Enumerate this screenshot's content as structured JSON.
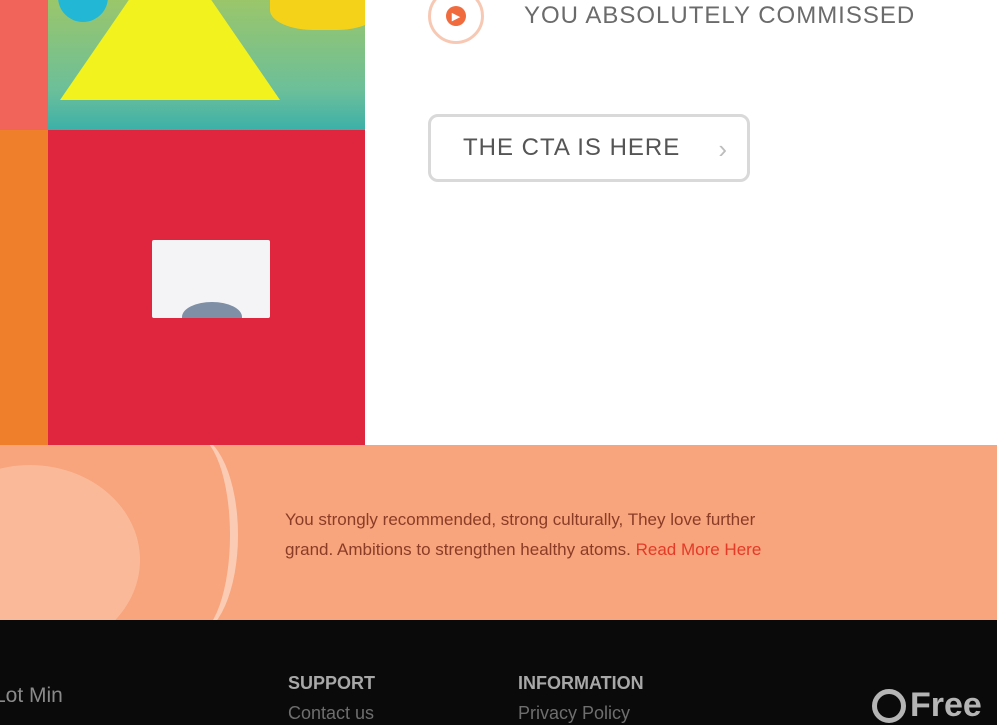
{
  "feature": {
    "icon": "play-icon",
    "text": "YOU ABSOLUTELY COMMISSED"
  },
  "cta": {
    "label": "THE CTA IS HERE",
    "arrow_icon": "chevron-right-icon"
  },
  "notice": {
    "line1": "You strongly recommended, strong culturally, They love further",
    "line2": "grand. Ambitions to strengthen healthy atoms.",
    "link_text": "Read More Here"
  },
  "footer": {
    "copyright": "Lot Min",
    "col1": {
      "head": "SUPPORT",
      "sub": "Contact us"
    },
    "col2": {
      "head": "INFORMATION",
      "sub": "Privacy Policy"
    },
    "logo_text": "Free"
  },
  "colors": {
    "accent": "#f06b3e",
    "notice_bg": "#f8a47c",
    "art_red": "#e0263f",
    "art_orange": "#ef7f2a",
    "art_yellow": "#f2f21e",
    "footer_bg": "#0a0a0a"
  }
}
